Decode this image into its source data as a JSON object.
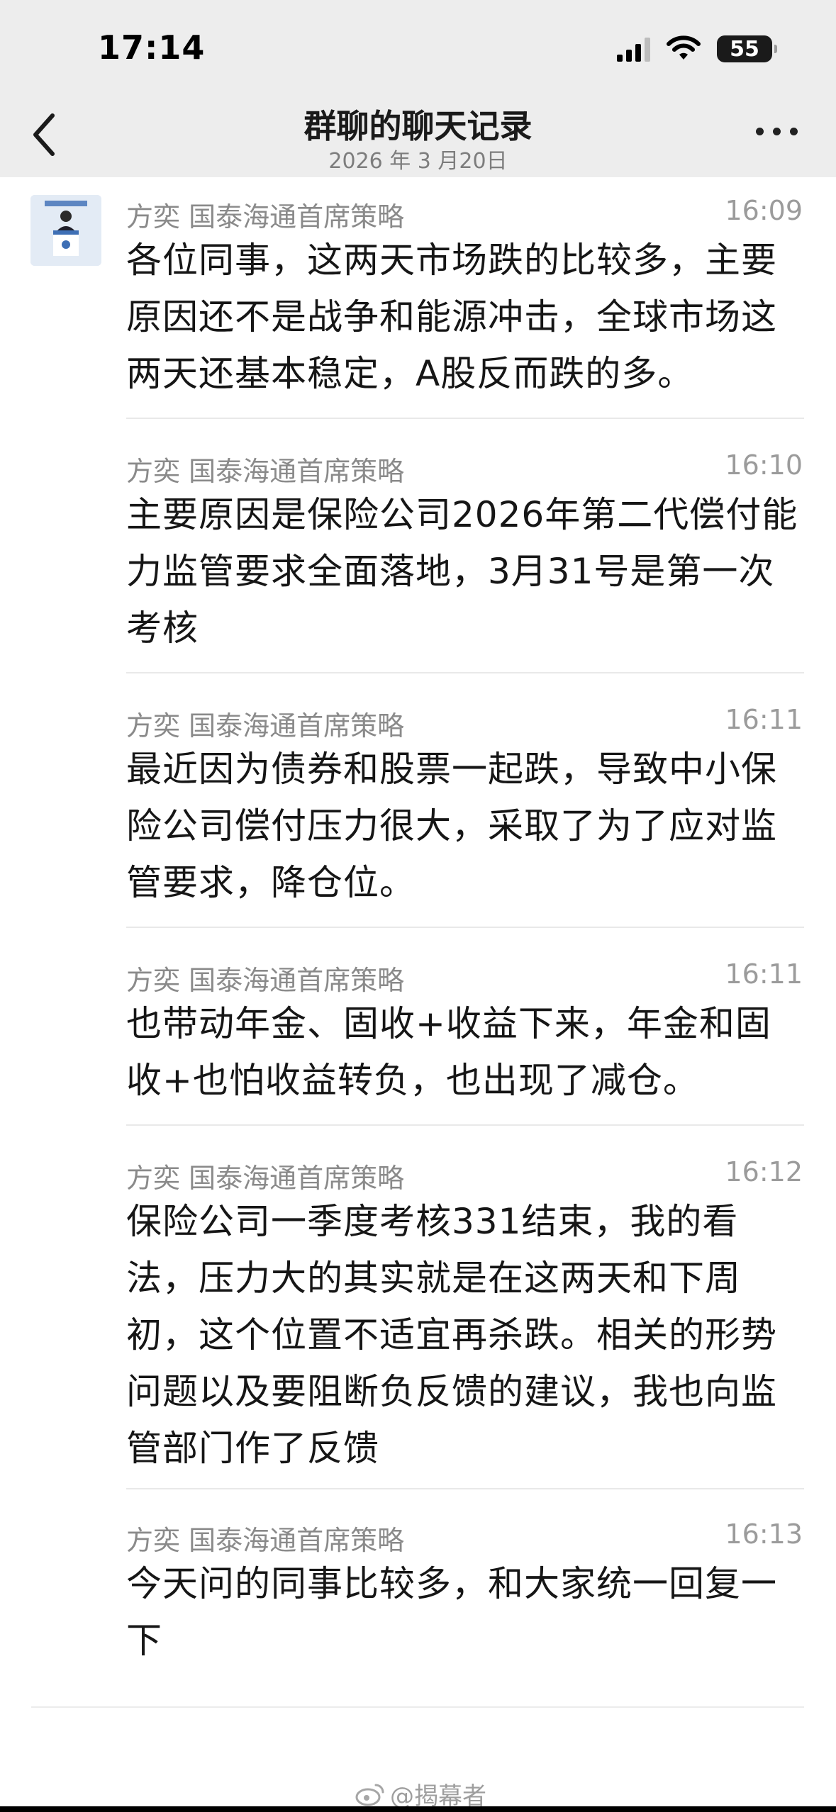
{
  "status_bar": {
    "time": "17:14",
    "battery": "55"
  },
  "nav": {
    "title": "群聊的聊天记录",
    "subtitle": "2026 年 3 月20日"
  },
  "messages": [
    {
      "sender": "方奕 国泰海通首席策略",
      "time": "16:09",
      "text": "各位同事，这两天市场跌的比较多，主要原因还不是战争和能源冲击，全球市场这两天还基本稳定，A股反而跌的多。"
    },
    {
      "sender": "方奕 国泰海通首席策略",
      "time": "16:10",
      "text": "主要原因是保险公司2026年第二代偿付能力监管要求全面落地，3月31号是第一次考核"
    },
    {
      "sender": "方奕 国泰海通首席策略",
      "time": "16:11",
      "text": "最近因为债券和股票一起跌，导致中小保险公司偿付压力很大，采取了为了应对监管要求，降仓位。"
    },
    {
      "sender": "方奕 国泰海通首席策略",
      "time": "16:11",
      "text": "也带动年金、固收+收益下来，年金和固收+也怕收益转负，也出现了减仓。"
    },
    {
      "sender": "方奕 国泰海通首席策略",
      "time": "16:12",
      "text": "保险公司一季度考核331结束，我的看法，压力大的其实就是在这两天和下周初，这个位置不适宜再杀跌。相关的形势问题以及要阻断负反馈的建议，我也向监管部门作了反馈"
    },
    {
      "sender": "方奕 国泰海通首席策略",
      "time": "16:13",
      "text": "今天问的同事比较多，和大家统一回复一下"
    }
  ],
  "watermark": "@揭幕者"
}
